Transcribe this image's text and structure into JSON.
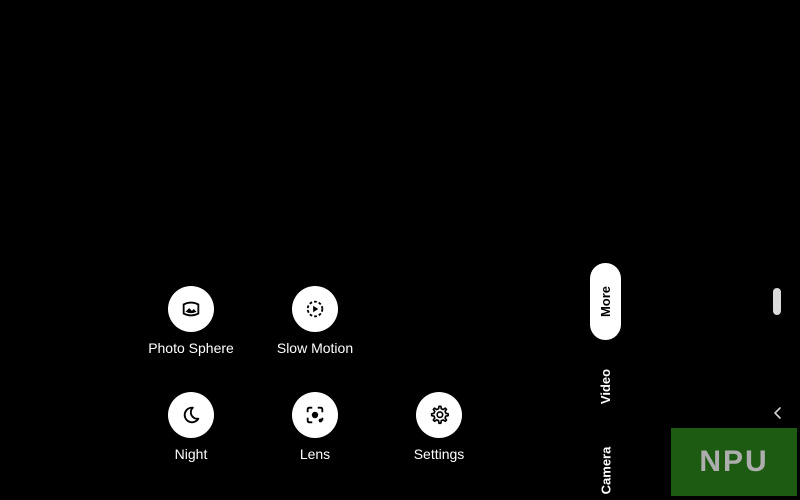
{
  "modes_grid": [
    {
      "label": "Photo Sphere",
      "icon": "photo-sphere-icon"
    },
    {
      "label": "Slow Motion",
      "icon": "slow-motion-icon"
    },
    {
      "label": "Night",
      "icon": "night-moon-icon"
    },
    {
      "label": "Lens",
      "icon": "lens-icon"
    },
    {
      "label": "Settings",
      "icon": "gear-icon"
    }
  ],
  "mode_strip": {
    "active": "More",
    "items": [
      "More",
      "Video",
      "Camera"
    ]
  },
  "watermark": {
    "text": "NPU"
  },
  "colors": {
    "background": "#000000",
    "button": "#ffffff",
    "watermark_bg": "#1f5f14"
  }
}
